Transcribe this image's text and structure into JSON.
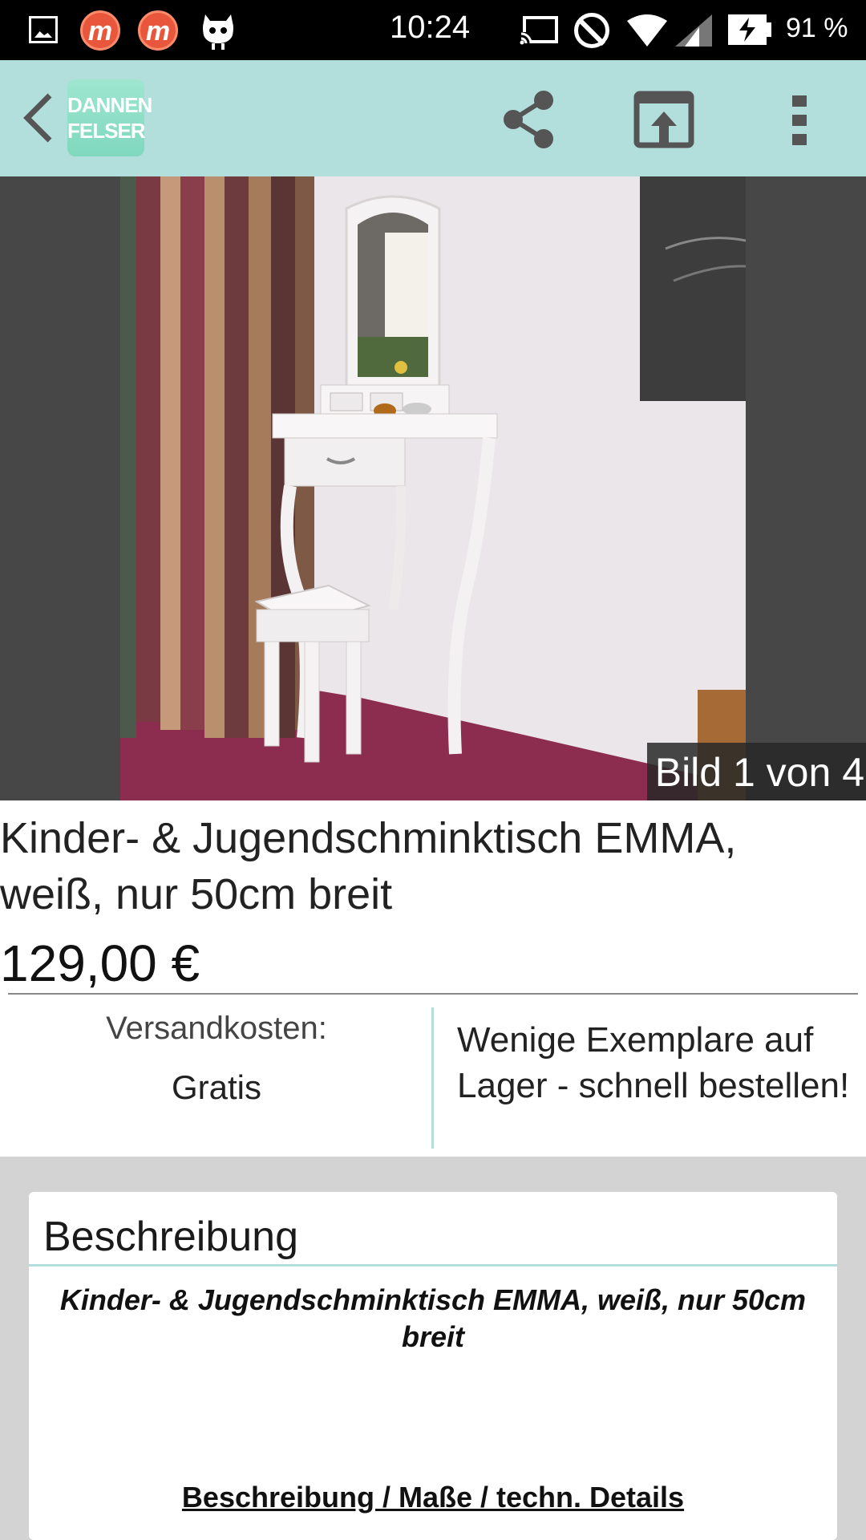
{
  "status_bar": {
    "time": "10:24",
    "battery": "91 %",
    "notif_app_letter": "m"
  },
  "app_bar": {
    "logo_line1": "DANNEN",
    "logo_line2": "FELSER",
    "accent_color": "#b2dfdb"
  },
  "gallery": {
    "counter": "Bild 1 von 4"
  },
  "product": {
    "title": "Kinder- & Jugendschminktisch EMMA, weiß, nur 50cm breit",
    "price": "129,00 €",
    "shipping_label": "Versandkosten:",
    "shipping_value": "Gratis",
    "stock_note": "Wenige Exemplare auf Lager - schnell bestellen!"
  },
  "description": {
    "heading": "Beschreibung",
    "subtitle": "Kinder- & Jugendschminktisch EMMA, weiß, nur 50cm breit",
    "details_link": "Beschreibung / Maße / techn. Details"
  }
}
